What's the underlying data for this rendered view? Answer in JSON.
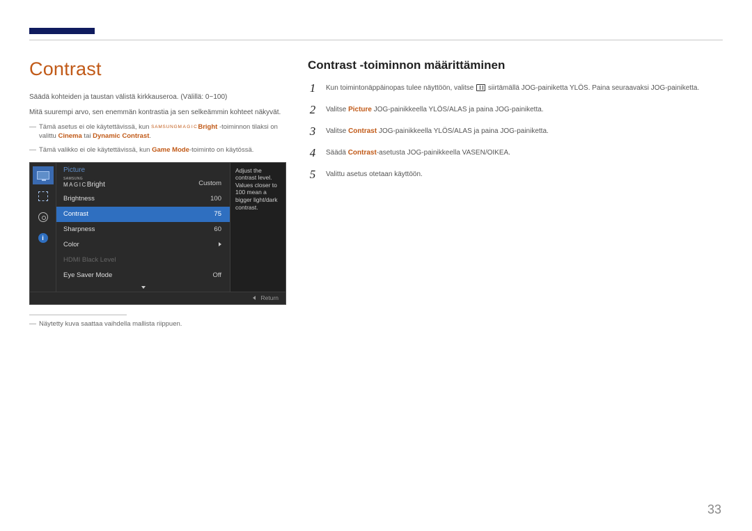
{
  "accent_color": "#c15a18",
  "page_number": "33",
  "left": {
    "heading": "Contrast",
    "p1": "Säädä kohteiden ja taustan välistä kirkkauseroa. (Välillä: 0~100)",
    "p2": "Mitä suurempi arvo, sen enemmän kontrastia ja sen selkeämmin kohteet näkyvät.",
    "note1_pre": "Tämä asetus ei ole käytettävissä, kun ",
    "note1_magic_tiny": "SAMSUNG",
    "note1_magic": "MAGIC",
    "note1_bright": "Bright",
    "note1_mid": " -toiminnon tilaksi on valittu ",
    "note1_cinema": "Cinema",
    "note1_or": " tai ",
    "note1_dyn": "Dynamic Contrast",
    "note1_end": ".",
    "note2_pre": "Tämä valikko ei ole käytettävissä, kun ",
    "note2_game": "Game Mode",
    "note2_end": "-toiminto on käytössä.",
    "footnote": "Näytetty kuva saattaa vaihdella mallista riippuen."
  },
  "osd": {
    "title": "Picture",
    "hint": "Adjust the contrast level. Values closer to 100 mean a bigger light/dark contrast.",
    "return": "Return",
    "rows": [
      {
        "label_type": "magic",
        "label": "Bright",
        "value": "Custom",
        "selected": false
      },
      {
        "label": "Brightness",
        "value": "100",
        "selected": false
      },
      {
        "label": "Contrast",
        "value": "75",
        "selected": true
      },
      {
        "label": "Sharpness",
        "value": "60",
        "selected": false
      },
      {
        "label": "Color",
        "value_type": "arrow",
        "selected": false
      },
      {
        "label": "HDMI Black Level",
        "value": "",
        "dim": true,
        "selected": false
      },
      {
        "label": "Eye Saver Mode",
        "value": "Off",
        "selected": false
      }
    ]
  },
  "right": {
    "heading": "Contrast -toiminnon määrittäminen",
    "steps": [
      {
        "num": "1",
        "pre": "Kun toimintonäppäinopas tulee näyttöön, valitse ",
        "icon": true,
        "post": " siirtämällä JOG-painiketta YLÖS. Paina seuraavaksi JOG-painiketta."
      },
      {
        "num": "2",
        "pre": "Valitse ",
        "emph": "Picture",
        "post": " JOG-painikkeella YLÖS/ALAS ja paina JOG-painiketta."
      },
      {
        "num": "3",
        "pre": "Valitse ",
        "emph": "Contrast",
        "post": " JOG-painikkeella YLÖS/ALAS ja paina JOG-painiketta."
      },
      {
        "num": "4",
        "pre": "Säädä ",
        "emph": "Contrast",
        "post": "-asetusta JOG-painikkeella VASEN/OIKEA."
      },
      {
        "num": "5",
        "pre": "Valittu asetus otetaan käyttöön."
      }
    ]
  }
}
